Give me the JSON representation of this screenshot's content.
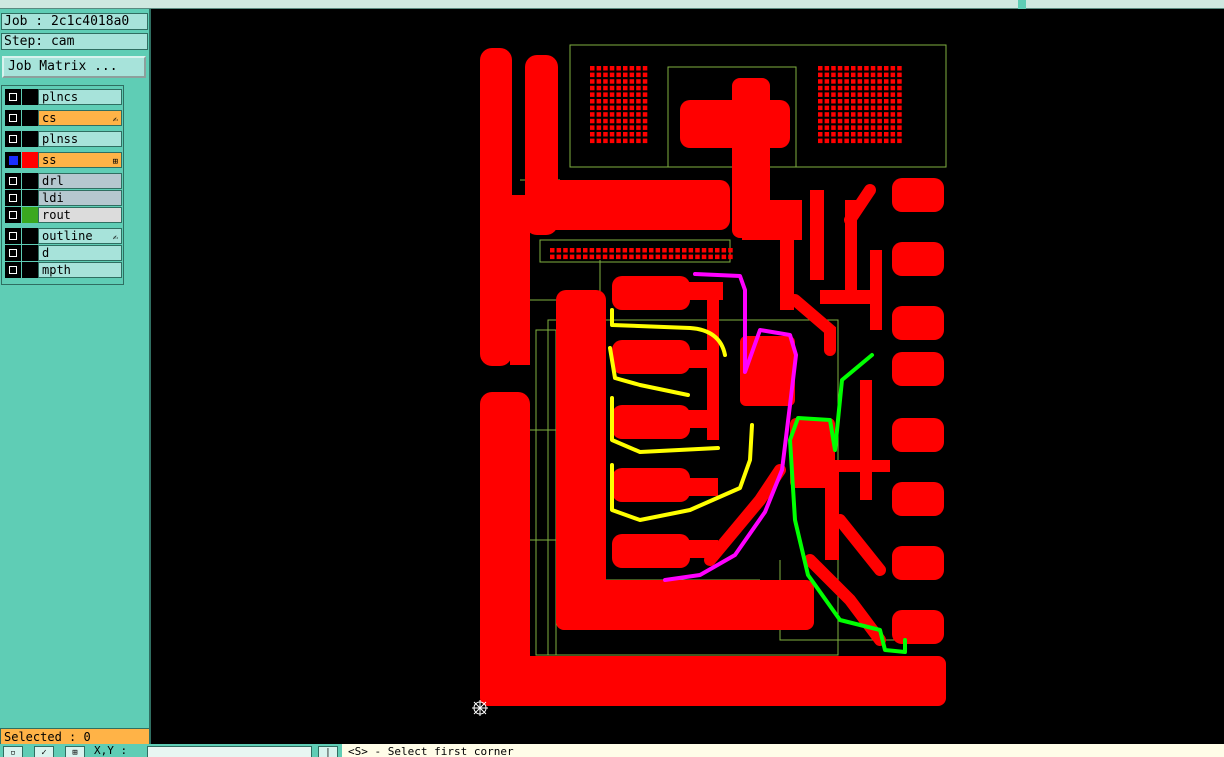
{
  "panel": {
    "job_label": "Job : 2c1c4018a0",
    "step_label": "Step: cam",
    "job_matrix_button": "Job Matrix ...",
    "selected_label": "Selected : 0"
  },
  "layers": [
    {
      "name": "plncs",
      "bg": "#a7e3da",
      "swatch": "#000000",
      "active": false,
      "mark": ""
    },
    {
      "name": "cs",
      "bg": "#ffb347",
      "swatch": "#000000",
      "active": false,
      "mark": "✍"
    },
    {
      "name": "plnss",
      "bg": "#a7e3da",
      "swatch": "#000000",
      "active": false,
      "mark": ""
    },
    {
      "name": "ss",
      "bg": "#ffb347",
      "swatch": "#ff0000",
      "active": true,
      "mark": "⊞"
    },
    {
      "name": "drl",
      "bg": "#b5c7cf",
      "swatch": "#000000",
      "active": false,
      "mark": ""
    },
    {
      "name": "ldi",
      "bg": "#b5c7cf",
      "swatch": "#000000",
      "active": false,
      "mark": ""
    },
    {
      "name": "rout",
      "bg": "#dcdcdc",
      "swatch": "#3aa820",
      "active": false,
      "mark": ""
    },
    {
      "name": "outline",
      "bg": "#a7e3da",
      "swatch": "#000000",
      "active": false,
      "mark": "✍"
    },
    {
      "name": "d",
      "bg": "#a7e3da",
      "swatch": "#000000",
      "active": false,
      "mark": ""
    },
    {
      "name": "mpth",
      "bg": "#a7e3da",
      "swatch": "#000000",
      "active": false,
      "mark": ""
    }
  ],
  "bottombar": {
    "xy_label": "X,Y :",
    "xy_value": "",
    "status_message": "<S>  - Select first corner"
  },
  "colors": {
    "copper": "#ff0000",
    "outline": "#7fb040",
    "trace_yellow": "#ffff00",
    "trace_magenta": "#ff00ff",
    "trace_green": "#00ff00"
  }
}
